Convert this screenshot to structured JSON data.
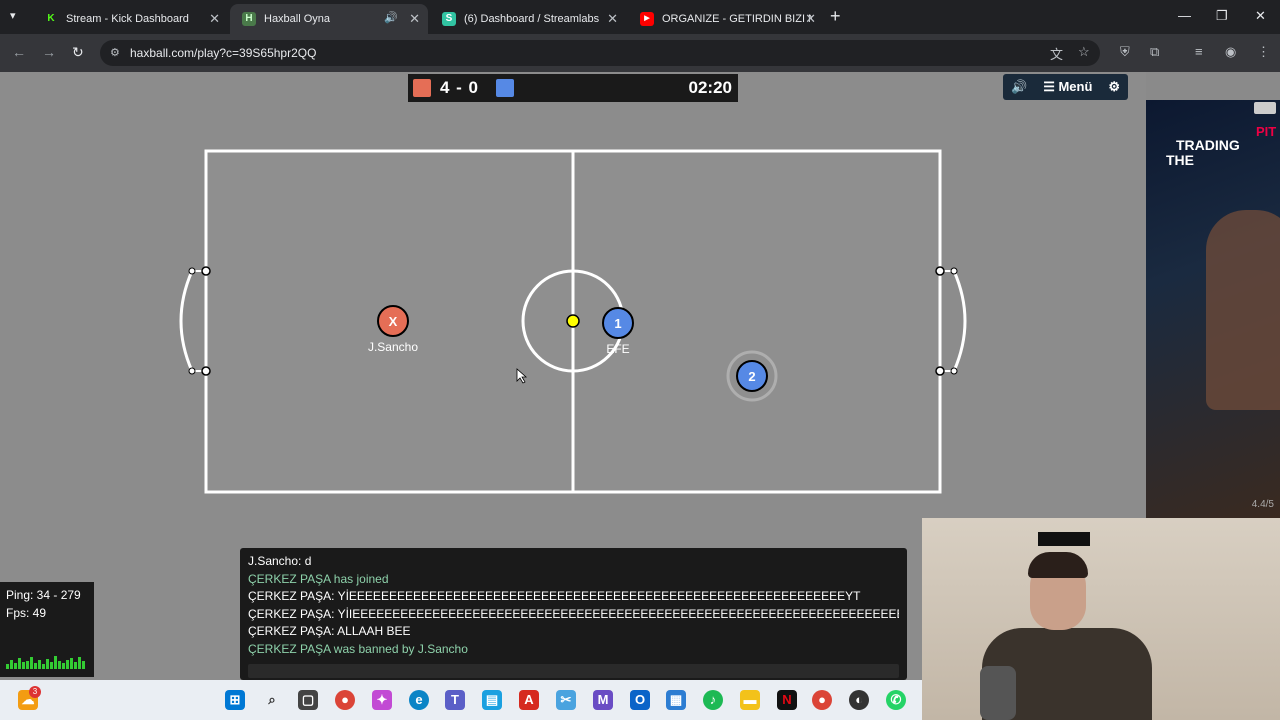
{
  "browser": {
    "tabs": [
      {
        "title": "Stream - Kick Dashboard",
        "icon": "kick-icon",
        "active": false
      },
      {
        "title": "Haxball Oyna",
        "icon": "haxball-icon",
        "active": true
      },
      {
        "title": "(6) Dashboard / Streamlabs",
        "icon": "streamlabs-icon",
        "active": false
      },
      {
        "title": "ORGANIZE - GETIRDIN BIZI NE",
        "icon": "youtube-icon",
        "active": false
      }
    ],
    "new_tab": "+",
    "url": "haxball.com/play?c=39S65hpr2QQ"
  },
  "game": {
    "score": "4 - 0",
    "time": "02:20",
    "menu_label": "Menü",
    "players": [
      {
        "label": "X",
        "name": "J.Sancho",
        "team": "red"
      },
      {
        "label": "1",
        "name": "EFE",
        "team": "blue"
      },
      {
        "label": "2",
        "name": "",
        "team": "blue"
      }
    ],
    "colors": {
      "red": "#e56e56",
      "blue": "#5689e5",
      "ball": "#ffff00",
      "pitch": "#8c8c8c"
    }
  },
  "chat": {
    "lines": [
      {
        "text": "J.Sancho: d",
        "type": "message"
      },
      {
        "text": "ÇERKEZ PAŞA has joined",
        "type": "notice"
      },
      {
        "text": "ÇERKEZ PAŞA: YİEEEEEEEEEEEEEEEEEEEEEEEEEEEEEEEEEEEEEEEEEEEEEEEEEEEEEEEEEEEEEEYT",
        "type": "message"
      },
      {
        "text": "ÇERKEZ PAŞA: YİIEEEEEEEEEEEEEEEEEEEEEEEEEEEEEEEEEEEEEEEEEEEEEEEEEEEEEEEEEEEEEEEEEEEEEEEYTÜ LEN",
        "type": "message"
      },
      {
        "text": "ÇERKEZ PAŞA: ALLAAH BEE",
        "type": "message"
      },
      {
        "text": "ÇERKEZ PAŞA was banned by J.Sancho",
        "type": "notice"
      }
    ]
  },
  "stats": {
    "ping": "Ping: 34 - 279",
    "fps": "Fps: 49"
  },
  "ad": {
    "line1": "PIT",
    "line2": "TRADING",
    "line3": "THE",
    "rating": "4.4/5"
  },
  "taskbar": {
    "notification_count": "3"
  }
}
